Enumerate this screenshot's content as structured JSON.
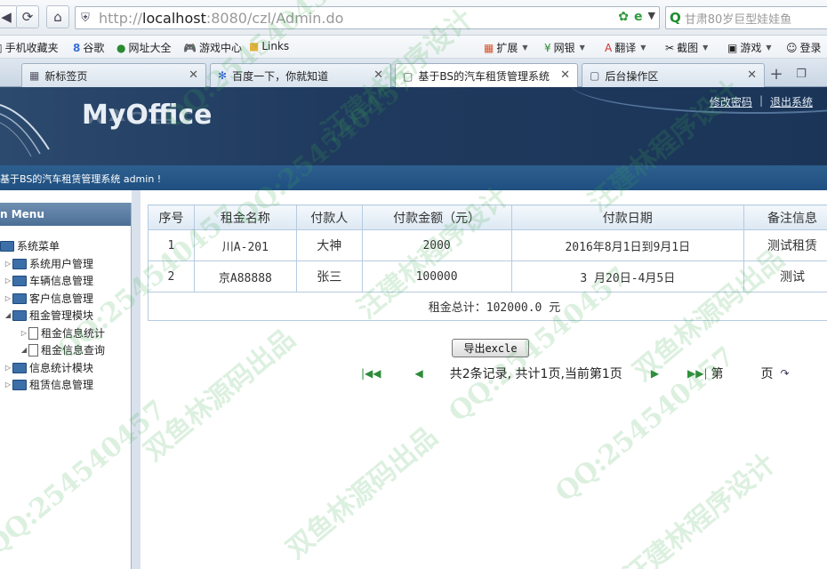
{
  "browser": {
    "url_prefix": "http://",
    "url_host": "localhost",
    "url_rest": ":8080/czl/Admin.do",
    "search_text": "甘肃80岁巨型娃娃鱼",
    "favorites": [
      {
        "label": "手机收藏夹",
        "icon": "phone-icon"
      },
      {
        "label": "谷歌",
        "icon": "google-icon"
      },
      {
        "label": "网址大全",
        "icon": "web-icon"
      },
      {
        "label": "游戏中心",
        "icon": "gamepad-icon"
      },
      {
        "label": "Links",
        "icon": "folder-icon"
      }
    ],
    "tools": [
      {
        "label": "扩展",
        "icon": "grid-icon"
      },
      {
        "label": "网银",
        "icon": "bank-icon"
      },
      {
        "label": "翻译",
        "icon": "translate-icon"
      },
      {
        "label": "截图",
        "icon": "scissors-icon"
      },
      {
        "label": "游戏",
        "icon": "gamepad-icon"
      },
      {
        "label": "登录",
        "icon": "user-icon"
      }
    ],
    "tabs": [
      {
        "label": "新标签页"
      },
      {
        "label": "百度一下，你就知道"
      },
      {
        "label": "基于BS的汽车租赁管理系统"
      },
      {
        "label": "后台操作区"
      }
    ]
  },
  "header": {
    "logo": "MyOffice",
    "change_password": "修改密码",
    "separator": "|",
    "logout": "退出系统",
    "welcome": "基于BS的汽车租赁管理系统 admin !"
  },
  "sidebar": {
    "title": "n Menu",
    "root": "系统菜单",
    "items": [
      {
        "label": "系统用户管理"
      },
      {
        "label": "车辆信息管理"
      },
      {
        "label": "客户信息管理"
      },
      {
        "label": "租金管理模块"
      },
      {
        "label": "租金信息统计"
      },
      {
        "label": "租金信息查询"
      },
      {
        "label": "信息统计模块"
      },
      {
        "label": "租赁信息管理"
      }
    ]
  },
  "table": {
    "headers": [
      "序号",
      "租金名称",
      "付款人",
      "付款金额（元）",
      "付款日期",
      "备注信息"
    ],
    "rows": [
      [
        "1",
        "川A-201",
        "大神",
        "2000",
        "2016年8月1日到9月1日",
        "测试租赁"
      ],
      [
        "2",
        "京A88888",
        "张三",
        "100000",
        "3 月20日-4月5日",
        "测试"
      ]
    ],
    "total": "租金总计：102000.0 元"
  },
  "actions": {
    "export": "导出excle"
  },
  "pager": {
    "summary": "共2条记录, 共计1页,当前第1页",
    "page_prefix": "第",
    "page_suffix": "页"
  },
  "watermark": {
    "qq": "QQ:254540457",
    "author": "汪建林程序设计",
    "source": "双鱼林源码出品"
  }
}
